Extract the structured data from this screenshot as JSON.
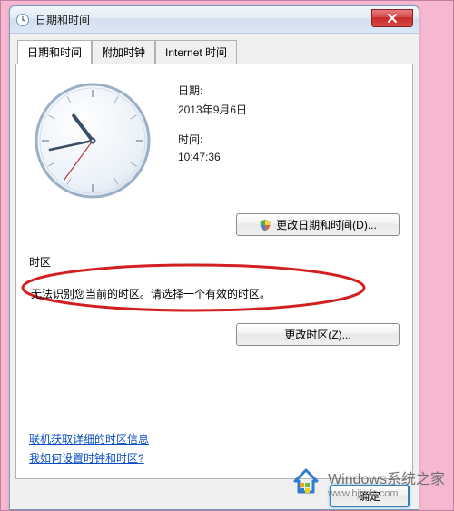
{
  "window": {
    "title": "日期和时间"
  },
  "tabs": {
    "items": [
      {
        "label": "日期和时间"
      },
      {
        "label": "附加时钟"
      },
      {
        "label": "Internet 时间"
      }
    ]
  },
  "date": {
    "label": "日期:",
    "value": "2013年9月6日"
  },
  "time": {
    "label": "时间:",
    "value": "10:47:36"
  },
  "clock": {
    "hour": 10,
    "minute": 47,
    "second": 36
  },
  "buttons": {
    "change_datetime": "更改日期和时间(D)...",
    "change_timezone": "更改时区(Z)...",
    "ok": "确定"
  },
  "timezone": {
    "label": "时区",
    "message": "无法识别您当前的时区。请选择一个有效的时区。"
  },
  "links": {
    "detailed_tz": "联机获取详细的时区信息",
    "how_set": "我如何设置时钟和时区?"
  },
  "watermark": {
    "brand": "Windows",
    "suffix": "系统之家",
    "url": "www.bjjmlv.com"
  }
}
